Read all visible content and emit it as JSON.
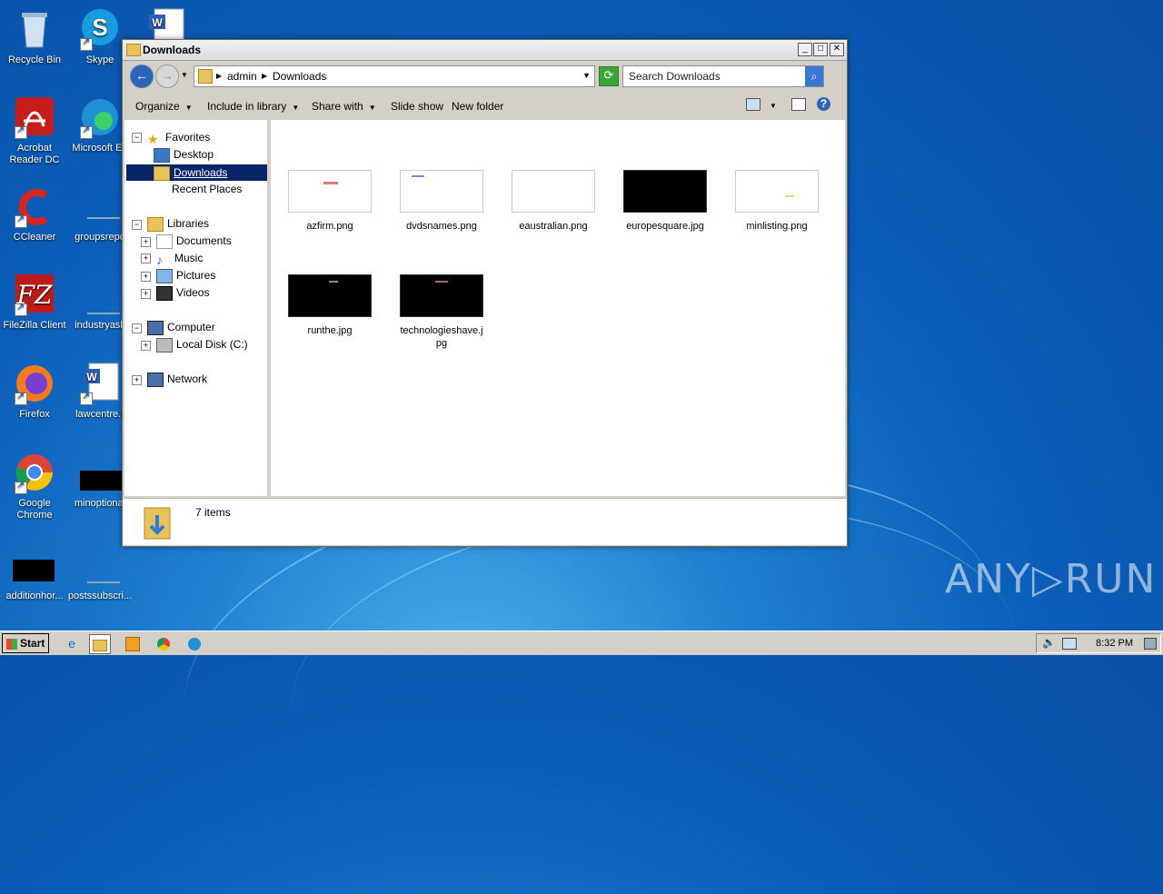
{
  "desktop": {
    "icons": [
      {
        "label": "Recycle Bin"
      },
      {
        "label": "Skype"
      },
      {
        "label": "Acrobat Reader DC"
      },
      {
        "label": "Microsoft Ed"
      },
      {
        "label": "CCleaner"
      },
      {
        "label": "groupsrepo"
      },
      {
        "label": "FileZilla Client"
      },
      {
        "label": "industryask"
      },
      {
        "label": "Firefox"
      },
      {
        "label": "lawcentre.r"
      },
      {
        "label": "Google Chrome"
      },
      {
        "label": "minoptional"
      },
      {
        "label": "additionhor..."
      },
      {
        "label": "postssubscri..."
      }
    ]
  },
  "window": {
    "title": "Downloads",
    "address": {
      "segment1": "admin",
      "segment2": "Downloads"
    },
    "search_placeholder": "Search Downloads",
    "toolbar": {
      "organize": "Organize",
      "include": "Include in library",
      "share": "Share with",
      "slideshow": "Slide show",
      "newfolder": "New folder"
    },
    "nav": {
      "favorites": "Favorites",
      "desktop": "Desktop",
      "downloads": "Downloads",
      "recent": "Recent Places",
      "libraries": "Libraries",
      "documents": "Documents",
      "music": "Music",
      "pictures": "Pictures",
      "videos": "Videos",
      "computer": "Computer",
      "localdisk": "Local Disk (C:)",
      "network": "Network"
    },
    "files": [
      {
        "name": "azfirm.png"
      },
      {
        "name": "dvdsnames.png"
      },
      {
        "name": "eaustralian.png"
      },
      {
        "name": "europesquare.jpg"
      },
      {
        "name": "minlisting.png"
      },
      {
        "name": "runthe.jpg"
      },
      {
        "name": "technologieshave.jpg"
      }
    ],
    "status": "7 items"
  },
  "taskbar": {
    "start": "Start",
    "clock": "8:32 PM"
  },
  "watermark": "ANY▷RUN"
}
